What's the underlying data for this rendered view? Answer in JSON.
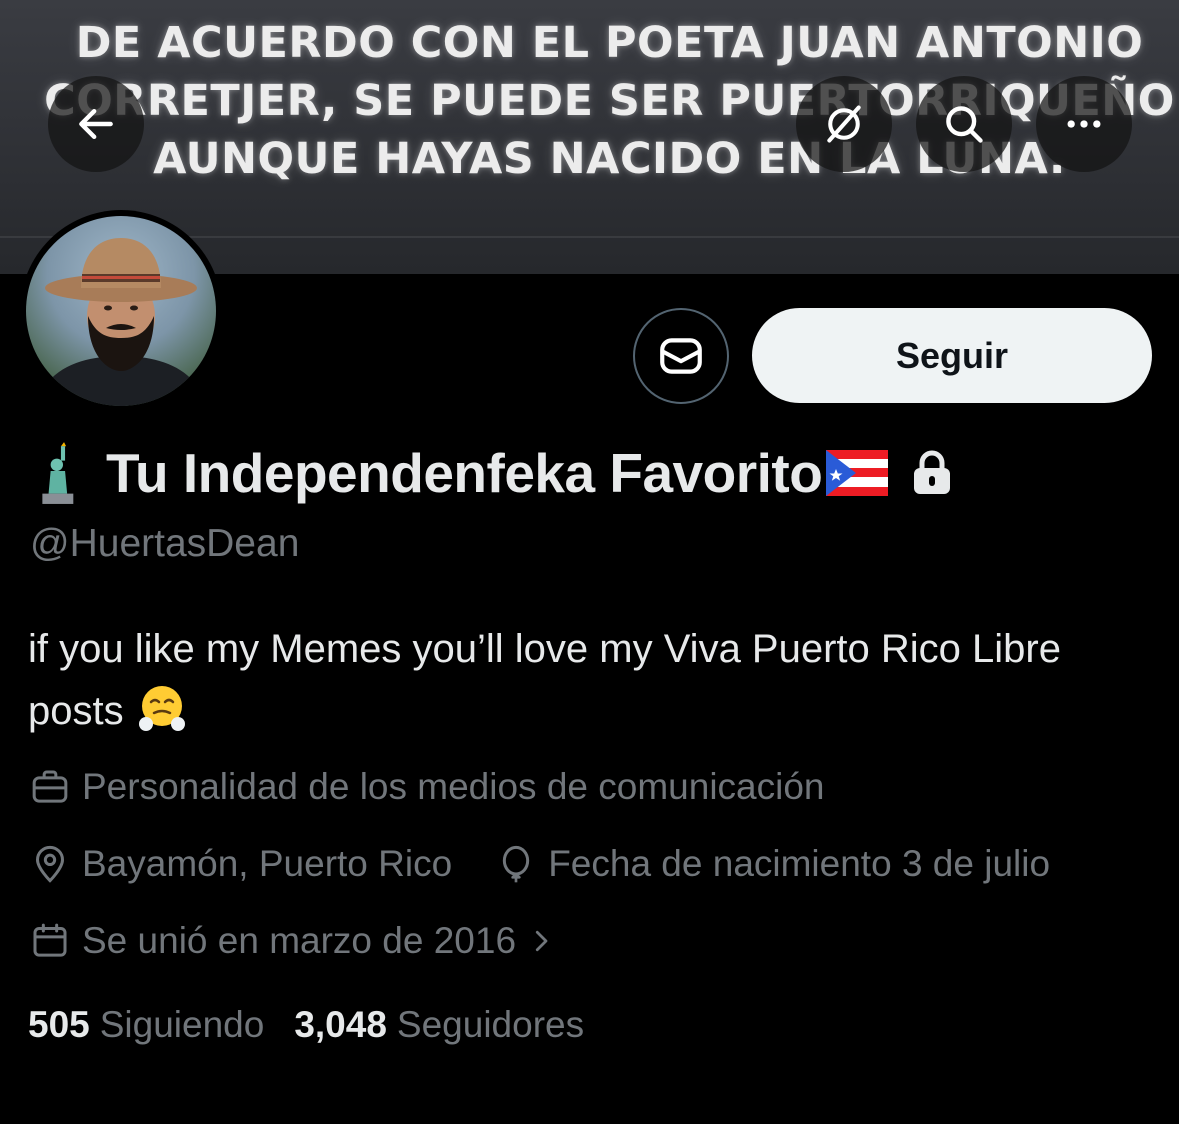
{
  "banner": {
    "lines": [
      "DE ACUERDO CON EL POETA JUAN ANTONIO",
      "CORRETJER, SE PUEDE SER PUERTORRIQUEÑO",
      "AUNQUE HAYAS NACIDO EN LA LUNA."
    ]
  },
  "toolbar": {
    "back_icon": "arrow-left-icon",
    "grok_icon": "grok-icon",
    "search_icon": "search-icon",
    "more_icon": "more-icon"
  },
  "profile": {
    "display_name": "Tu Independenfeka Favorito",
    "name_prefix_emoji": "statue-of-liberty-emoji",
    "name_suffix_emoji": "puerto-rico-flag-emoji",
    "protected_icon": "lock-icon",
    "handle": "@HuertasDean",
    "bio": "if you like my Memes you’ll love my Viva Puerto Rico Libre posts",
    "bio_emoji": "face-with-steam-emoji",
    "category": "Personalidad de los medios de comunicación",
    "location": "Bayamón, Puerto Rico",
    "birthday": "Fecha de nacimiento 3 de julio",
    "joined": "Se unió en marzo de 2016"
  },
  "actions": {
    "message_icon": "envelope-icon",
    "follow_label": "Seguir"
  },
  "stats": {
    "following_count": "505",
    "following_label": "Siguiendo",
    "followers_count": "3,048",
    "followers_label": "Seguidores"
  },
  "colors": {
    "background": "#000000",
    "primary_text": "#e7e9ea",
    "secondary_text": "#71767b",
    "follow_button_bg": "#eff3f4",
    "border": "#536471"
  }
}
